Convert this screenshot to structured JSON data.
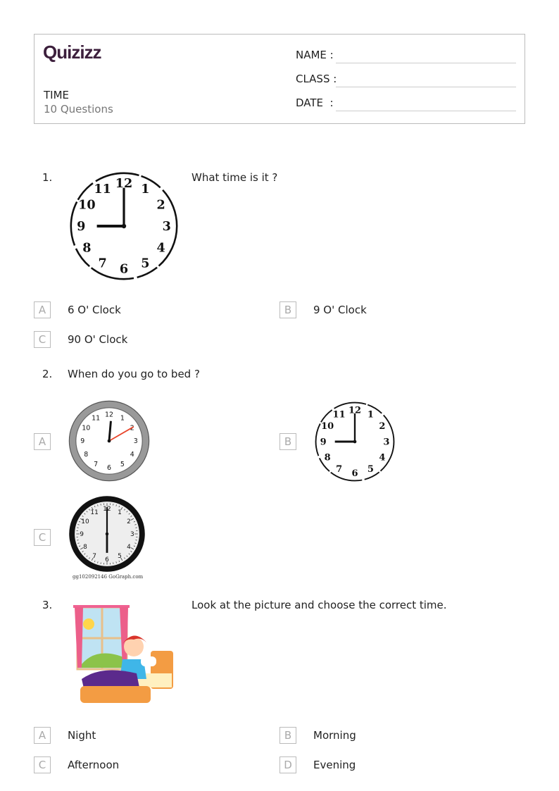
{
  "header": {
    "logo": "Quizizz",
    "title": "TIME",
    "subtitle": "10 Questions",
    "fields": [
      "NAME :",
      "CLASS :",
      "DATE  :"
    ]
  },
  "questions": [
    {
      "number": "1.",
      "text": "What time is it ?",
      "image": "clock showing 9:00",
      "options": [
        {
          "letter": "A",
          "text": "6 O' Clock"
        },
        {
          "letter": "B",
          "text": "9 O' Clock"
        },
        {
          "letter": "C",
          "text": "90 O' Clock"
        }
      ]
    },
    {
      "number": "2.",
      "text": "When do you go to bed ?",
      "options": [
        {
          "letter": "A",
          "image": "clock-icon"
        },
        {
          "letter": "B",
          "image": "clock-icon"
        },
        {
          "letter": "C",
          "image": "clock-icon",
          "watermark": "gg102092146 GoGraph.com"
        }
      ]
    },
    {
      "number": "3.",
      "text": "Look at the picture and choose the correct time.",
      "image": "girl waking up in bed",
      "options": [
        {
          "letter": "A",
          "text": "Night"
        },
        {
          "letter": "B",
          "text": "Morning"
        },
        {
          "letter": "C",
          "text": "Afternoon"
        },
        {
          "letter": "D",
          "text": "Evening"
        }
      ]
    }
  ],
  "colors": {
    "logo": "#3c1f3c",
    "border": "#bbbbbb",
    "red_hand": "#e8442a"
  }
}
